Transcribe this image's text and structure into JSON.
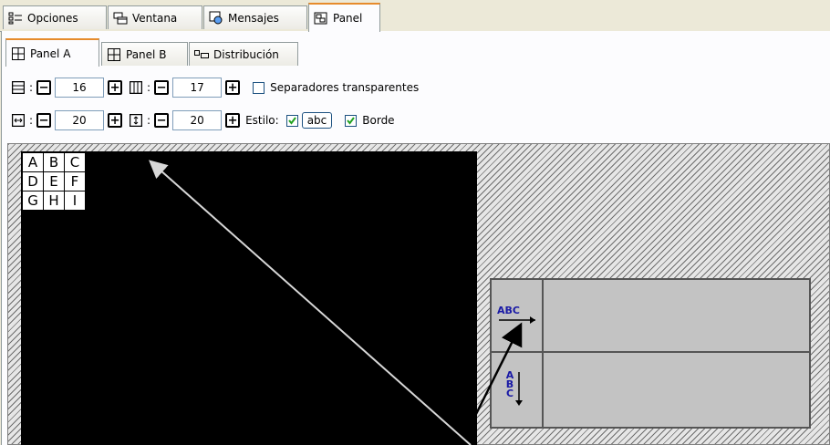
{
  "tabs": [
    {
      "label": "Opciones",
      "icon": "options-icon"
    },
    {
      "label": "Ventana",
      "icon": "window-icon"
    },
    {
      "label": "Mensajes",
      "icon": "messages-icon"
    },
    {
      "label": "Panel",
      "icon": "panel-icon",
      "active": true
    }
  ],
  "subtabs": [
    {
      "label": "Panel A",
      "icon": "grid-icon",
      "active": true
    },
    {
      "label": "Panel B",
      "icon": "grid-icon"
    },
    {
      "label": "Distribución",
      "icon": "layout-icon"
    }
  ],
  "controls": {
    "rows_value": "16",
    "cols_value": "17",
    "transparent_label": "Separadores transparentes",
    "transparent_checked": false,
    "h_gap_value": "20",
    "v_gap_value": "20",
    "style_label": "Estilo:",
    "style_abc": "abc",
    "style_checked": true,
    "border_label": "Borde",
    "border_checked": true
  },
  "sep": ":",
  "grid_letters": [
    [
      "A",
      "B",
      "C"
    ],
    [
      "D",
      "E",
      "F"
    ],
    [
      "G",
      "H",
      "I"
    ]
  ],
  "orientation": {
    "horizontal_text": "ABC",
    "vertical_text": [
      "A",
      "B",
      "C"
    ]
  },
  "colors": {
    "accent": "#e68b2c",
    "text_blue": "#1a1aa6",
    "check_green": "#21a121"
  }
}
